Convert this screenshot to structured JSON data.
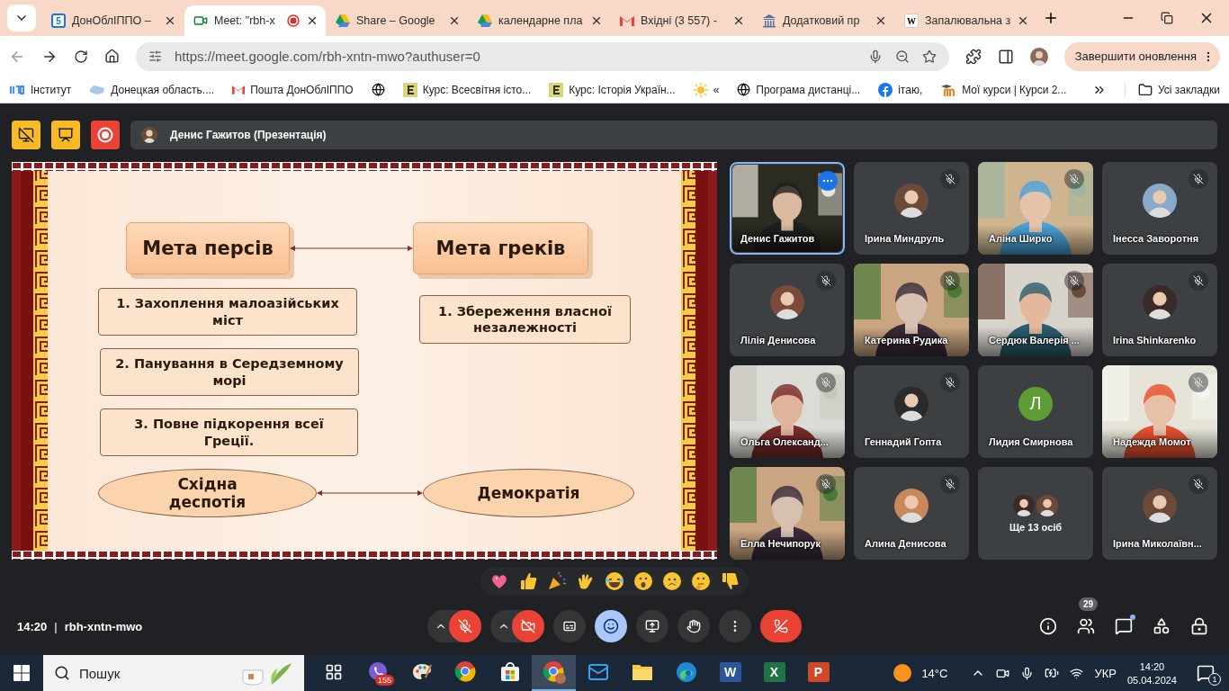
{
  "browser": {
    "tabs": [
      {
        "label": "ДонОблІППО –",
        "kind": "calendar",
        "glyph": "5",
        "selected": false,
        "recording": false
      },
      {
        "label": "Meet: \"rbh-x",
        "kind": "meet",
        "selected": true,
        "recording": true
      },
      {
        "label": "Share – Google",
        "kind": "drive",
        "selected": false,
        "recording": false
      },
      {
        "label": "календарне пла",
        "kind": "drive",
        "selected": false,
        "recording": false
      },
      {
        "label": "Вхідні (3 557) -",
        "kind": "gmail",
        "selected": false,
        "recording": false
      },
      {
        "label": "Додатковий пр",
        "kind": "building",
        "selected": false,
        "recording": false
      },
      {
        "label": "Запалювальна з",
        "kind": "wiki",
        "glyph": "W",
        "selected": false,
        "recording": false
      }
    ],
    "url": "https://meet.google.com/rbh-xntn-mwo?authuser=0",
    "update_button": "Завершити оновлення",
    "bookmarks": [
      {
        "label": "Інститут",
        "kind": "ippo"
      },
      {
        "label": "Донецкая область....",
        "kind": "map"
      },
      {
        "label": "Пошта ДонОблІППО",
        "kind": "gmail"
      },
      {
        "kind": "globe"
      },
      {
        "label": "Курс: Всесвітня істо...",
        "kind": "course"
      },
      {
        "label": "Курс: Історія Україн...",
        "kind": "course"
      },
      {
        "label": "«",
        "kind": "sun"
      },
      {
        "label": "Програма дистанці...",
        "kind": "globe"
      },
      {
        "label": "ітаю,",
        "kind": "facebook"
      },
      {
        "label": "Мої курси | Курси 2...",
        "kind": "moodle"
      }
    ],
    "all_bookmarks": "Усі закладки"
  },
  "meet": {
    "presenter": "Денис Гажитов (Презентація)",
    "slide": {
      "goal_left": "Мета персів",
      "goal_right": "Мета греків",
      "left_items": [
        "1.  Захоплення малоазійських міст",
        "2. Панування в Середземному морі",
        "3. Повне підкорення всеї Греції."
      ],
      "right_items": [
        "1. Збереження власної незалежності"
      ],
      "regime_left": "Східна деспотія",
      "regime_right": "Демократія"
    },
    "participants": [
      {
        "name": "Денис Гажитов",
        "kind": "video",
        "muted": false,
        "active": true
      },
      {
        "name": "Ірина Миндруль",
        "kind": "avatar",
        "muted": true,
        "active": false
      },
      {
        "name": "Аліна Ширко",
        "kind": "video",
        "muted": true,
        "active": false
      },
      {
        "name": "Інесса Заворотня",
        "kind": "avatar",
        "muted": true,
        "active": false
      },
      {
        "name": "Лілія Денисова",
        "kind": "avatar",
        "muted": true,
        "active": false
      },
      {
        "name": "Катерина Рудика",
        "kind": "video",
        "muted": true,
        "active": false
      },
      {
        "name": "Сердюк Валерія ...",
        "kind": "video",
        "muted": true,
        "active": false
      },
      {
        "name": "Irina Shinkarenko",
        "kind": "avatar",
        "muted": true,
        "active": false
      },
      {
        "name": "Ольга Олександ...",
        "kind": "video",
        "muted": true,
        "active": false
      },
      {
        "name": "Геннадий Гопта",
        "kind": "avatar",
        "muted": true,
        "active": false
      },
      {
        "name": "Лидия Смирнова",
        "kind": "letter",
        "letter": "Л",
        "color": "#5e9d36",
        "muted": false,
        "active": false
      },
      {
        "name": "Надежда Момот",
        "kind": "video",
        "muted": true,
        "active": false
      },
      {
        "name": "Елла Нечипорук",
        "kind": "video",
        "muted": true,
        "active": false
      },
      {
        "name": "Алина Денисова",
        "kind": "avatar",
        "muted": true,
        "active": false
      },
      {
        "name": "Ще 13 осіб",
        "kind": "more",
        "muted": false,
        "active": false
      },
      {
        "name": "Ірина Миколаївн...",
        "kind": "avatar",
        "muted": true,
        "active": false
      }
    ],
    "time": "14:20",
    "separator": "|",
    "code": "rbh-xntn-mwo",
    "mic_muted": true,
    "camera_off": true,
    "people_count": "29",
    "chat_unread": true
  },
  "taskbar": {
    "search_placeholder": "Пошук",
    "apps": [
      {
        "kind": "taskview",
        "selected": false
      },
      {
        "kind": "viber",
        "badge": "155",
        "selected": false
      },
      {
        "kind": "paint",
        "selected": false
      },
      {
        "kind": "chrome",
        "selected": false
      },
      {
        "kind": "store",
        "selected": false
      },
      {
        "kind": "chrome-profile",
        "selected": true
      },
      {
        "kind": "mail",
        "selected": false
      },
      {
        "kind": "folder",
        "selected": false
      },
      {
        "kind": "edge",
        "selected": false
      },
      {
        "kind": "office",
        "glyph": "W",
        "color": "#2b579a",
        "selected": false
      },
      {
        "kind": "office",
        "glyph": "X",
        "color": "#217346",
        "selected": false
      },
      {
        "kind": "office",
        "glyph": "P",
        "color": "#d24726",
        "selected": false
      }
    ],
    "temperature": "14°C",
    "language": "УКР",
    "time": "14:20",
    "date": "05.04.2024",
    "notifications": "1"
  }
}
